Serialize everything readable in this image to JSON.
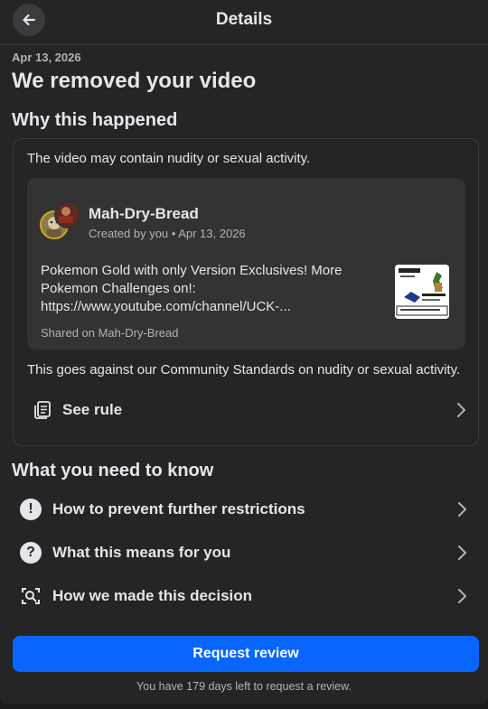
{
  "header": {
    "title": "Details",
    "back_icon": "arrow-left-icon"
  },
  "notice": {
    "date": "Apr 13, 2026",
    "title": "We removed your video"
  },
  "why": {
    "heading": "Why this happened",
    "reason": "The video may contain nudity or sexual activity.",
    "post": {
      "author": "Mah-Dry-Bread",
      "meta": "Created by you • Apr 13, 2026",
      "body": "Pokemon Gold with only Version Exclusives! More Pokemon Challenges on!: https://www.youtube.com/channel/UCK-...",
      "shared_on": "Shared on Mah-Dry-Bread"
    },
    "standards": "This goes against our Community Standards on nudity or sexual activity.",
    "see_rule": "See rule"
  },
  "know": {
    "heading": "What you need to know",
    "items": [
      {
        "label": "How to prevent further restrictions",
        "icon": "exclamation-circle-icon"
      },
      {
        "label": "What this means for you",
        "icon": "question-circle-icon"
      },
      {
        "label": "How we made this decision",
        "icon": "magnify-scan-icon"
      }
    ]
  },
  "actions": {
    "request_review": "Request review",
    "days_left_note": "You have 179 days left to request a review."
  },
  "colors": {
    "accent": "#0866ff",
    "panel": "#252526",
    "card": "#333334"
  }
}
